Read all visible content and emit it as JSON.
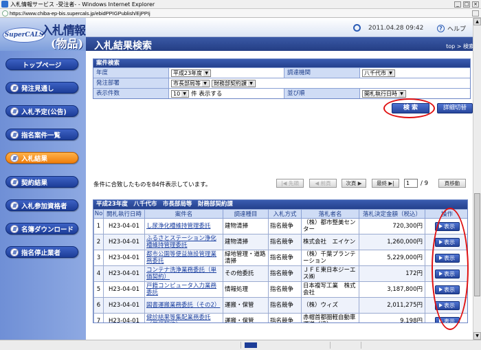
{
  "window": {
    "title": "入札情報サービス -受注者- - Windows Internet Explorer",
    "url": "https://www.chiba-ep-bis.supercals.jp/ebidPPIGPublish/EjPPIj"
  },
  "header": {
    "logo_mark": "SuperCALS",
    "logo_line1": "入札情報",
    "logo_line2": "(物品)",
    "datetime": "2011.04.28 09:42",
    "help_label": "ヘルプ",
    "page_title": "入札結果検索",
    "breadcrumb": "top > 検索"
  },
  "sidebar": {
    "items": [
      {
        "label": "トップページ"
      },
      {
        "label": "発注見通し"
      },
      {
        "label": "入札予定(公告)"
      },
      {
        "label": "指名案件一覧"
      },
      {
        "label": "入札結果"
      },
      {
        "label": "契約結果"
      },
      {
        "label": "入札参加資格者"
      },
      {
        "label": "名簿ダウンロード"
      },
      {
        "label": "指名停止業者"
      }
    ]
  },
  "search": {
    "caption": "案件検索",
    "year_label": "年度",
    "year_value": "平成23年度",
    "agency_label": "調達機関",
    "agency_value": "八千代市",
    "dept_label": "発注部署",
    "dept_value1": "市長部局等",
    "dept_value2": "財務部契約課",
    "count_label": "表示件数",
    "count_value": "10",
    "count_suffix": "件 表示する",
    "order_label": "並び順",
    "order_value": "開札執行日時",
    "search_button": "検 索",
    "detail_button": "詳細切替"
  },
  "pager": {
    "message": "条件に合致したものを84件表示しています。",
    "first": "|◀ 先頭",
    "prev": "◀ 前頁",
    "next": "次頁 ▶",
    "last": "最終 ▶|",
    "current_page": "1",
    "total_pages": "/ 9",
    "jump": "頁移動"
  },
  "results": {
    "caption": "平成23年度　八千代市　市長部局等　財務部契約課",
    "headers": [
      "No",
      "開札執行日時",
      "案件名",
      "調達種目",
      "入札方式",
      "落札者名",
      "落札決定金額（税込）",
      "操作"
    ],
    "show_label": "表示",
    "rows": [
      {
        "no": "1",
        "date": "H23-04-01",
        "name": "し尿浄化槽維持管理委託",
        "category": "建物清掃",
        "method": "指名競争",
        "winner": "（株）都市整美センター",
        "amount": "720,300円"
      },
      {
        "no": "2",
        "date": "H23-04-01",
        "name": "ふるさとステーション浄化槽維持管理委託",
        "category": "建物清掃",
        "method": "指名競争",
        "winner": "株式会社　エイケン",
        "amount": "1,260,000円"
      },
      {
        "no": "3",
        "date": "H23-04-01",
        "name": "都市公園等便益施設管理業務委託",
        "category": "緑地管理・道路清掃",
        "method": "指名競争",
        "winner": "（株）千葉プランテーション",
        "amount": "5,229,000円"
      },
      {
        "no": "4",
        "date": "H23-04-01",
        "name": "コンテナ洗浄業務委託（単価契約）",
        "category": "その他委託",
        "method": "指名競争",
        "winner": "ＪＦＥ東日本ジーエス㈱",
        "amount": "172円"
      },
      {
        "no": "5",
        "date": "H23-04-01",
        "name": "戸籍コンピュータ入力業務委託",
        "category": "情報処理",
        "method": "指名競争",
        "winner": "日本複写工業　株式会社",
        "amount": "3,187,800円"
      },
      {
        "no": "6",
        "date": "H23-04-01",
        "name": "図書運搬業務委託（その2）",
        "category": "運搬・保管",
        "method": "指名競争",
        "winner": "（株）ウィズ",
        "amount": "2,011,275円"
      },
      {
        "no": "7",
        "date": "H23-04-01",
        "name": "健診結果等集配業務委託（単価契約）",
        "category": "運搬・保管",
        "method": "指名競争",
        "winner": "赤帽首都圏軽自動車運送（協）",
        "amount": "9,198円"
      }
    ]
  },
  "colors": {
    "accent": "#24408c",
    "active_nav": "#f07e0c",
    "annotation": "#e01010"
  }
}
